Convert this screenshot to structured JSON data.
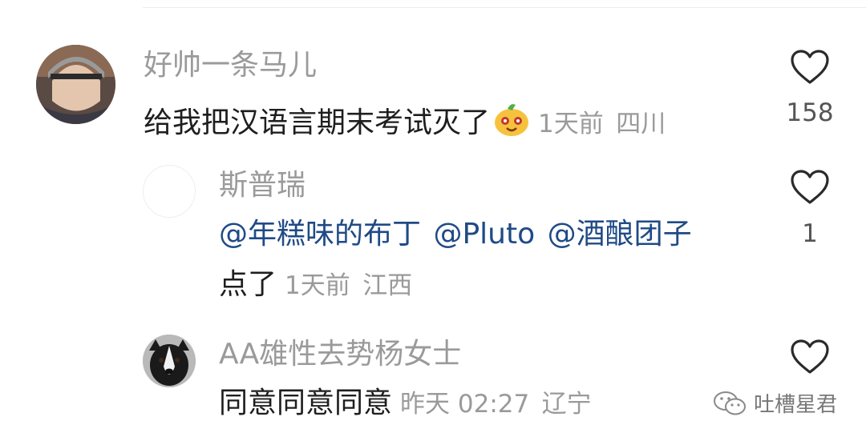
{
  "comments": [
    {
      "username": "好帅一条马儿",
      "text": "给我把汉语言期末考试灭了",
      "emoji": "melon-face-emoji",
      "time": "1天前",
      "location": "四川",
      "likes": "158"
    },
    {
      "username": "斯普瑞",
      "mentions": [
        "@年糕味的布丁",
        "@Pluto",
        "@酒酿团子"
      ],
      "text": "点了",
      "time": "1天前",
      "location": "江西",
      "likes": "1"
    },
    {
      "username": "AA雄性去势杨女士",
      "text": "同意同意同意",
      "time": "昨天 02:27",
      "location": "辽宁",
      "likes": ""
    }
  ],
  "watermark": {
    "text": "吐槽星君",
    "icon": "wechat-icon"
  },
  "colors": {
    "username": "#9a9a9a",
    "mention": "#1f4a86",
    "meta": "#9a9a9a"
  }
}
